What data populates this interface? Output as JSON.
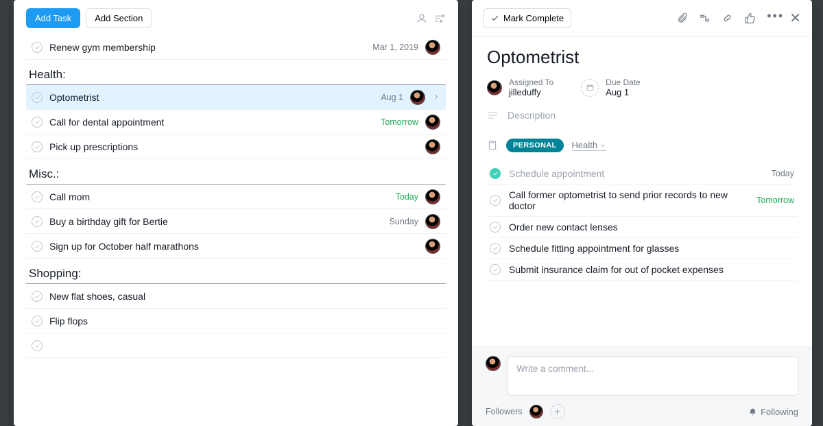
{
  "toolbar": {
    "add_task": "Add Task",
    "add_section": "Add Section"
  },
  "sections": [
    {
      "name": "",
      "tasks": [
        {
          "name": "Renew gym membership",
          "date": "Mar 1, 2019",
          "date_style": "",
          "avatar": true
        }
      ]
    },
    {
      "name": "Health:",
      "tasks": [
        {
          "name": "Optometrist",
          "date": "Aug 1",
          "date_style": "",
          "avatar": true,
          "selected": true,
          "chevron": true
        },
        {
          "name": "Call for dental appointment",
          "date": "Tomorrow",
          "date_style": "green",
          "avatar": true
        },
        {
          "name": "Pick up prescriptions",
          "date": "",
          "avatar": true
        }
      ]
    },
    {
      "name": "Misc.:",
      "tasks": [
        {
          "name": "Call mom",
          "date": "Today",
          "date_style": "green",
          "avatar": true
        },
        {
          "name": "Buy a birthday gift for Bertie",
          "date": "Sunday",
          "date_style": "",
          "avatar": true
        },
        {
          "name": "Sign up for October half marathons",
          "date": "",
          "avatar": true
        }
      ]
    },
    {
      "name": "Shopping:",
      "tasks": [
        {
          "name": "New flat shoes, casual",
          "date": "",
          "avatar": false
        },
        {
          "name": "Flip flops",
          "date": "",
          "avatar": false
        },
        {
          "name": "",
          "date": "",
          "avatar": false,
          "empty": true
        }
      ]
    }
  ],
  "detail": {
    "mark_complete": "Mark Complete",
    "title": "Optometrist",
    "assigned_label": "Assigned To",
    "assigned_value": "jilleduffy",
    "due_label": "Due Date",
    "due_value": "Aug 1",
    "description_label": "Description",
    "tag": "PERSONAL",
    "category": "Health",
    "subtasks": [
      {
        "name": "Schedule appointment",
        "date": "Today",
        "date_style": "",
        "done": true
      },
      {
        "name": "Call former optometrist to send prior records to new doctor",
        "date": "Tomorrow",
        "date_style": "green"
      },
      {
        "name": "Order new contact lenses",
        "date": ""
      },
      {
        "name": "Schedule fitting appointment for glasses",
        "date": ""
      },
      {
        "name": "Submit insurance claim for out of pocket expenses",
        "date": ""
      }
    ],
    "comment_placeholder": "Write a comment...",
    "followers_label": "Followers",
    "following_label": "Following"
  }
}
